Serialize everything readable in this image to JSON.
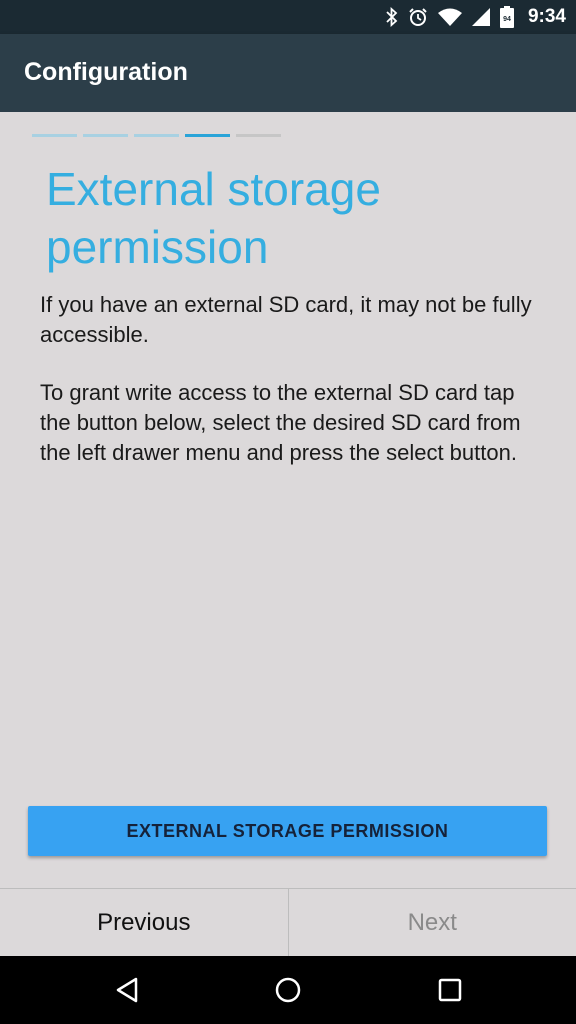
{
  "status_bar": {
    "time": "9:34",
    "battery_level": "94",
    "icons": [
      "bluetooth-icon",
      "alarm-icon",
      "wifi-icon",
      "signal-icon",
      "battery-icon"
    ]
  },
  "app_bar": {
    "title": "Configuration"
  },
  "wizard": {
    "steps_total": 5,
    "current_step": 4,
    "heading": "External storage permission",
    "paragraphs": [
      "If you have an external SD card, it may not be fully accessible.",
      "To grant write access to the external SD card tap the button below, select the desired SD card from the left drawer menu and press the select button."
    ],
    "permission_button_label": "EXTERNAL STORAGE PERMISSION"
  },
  "footer": {
    "previous_label": "Previous",
    "next_label": "Next"
  },
  "nav_bar": {
    "icons": [
      "back-icon",
      "home-icon",
      "recents-icon"
    ]
  },
  "colors": {
    "accent": "#35aee0",
    "button": "#37a2f2",
    "app_bar": "#2c3e49",
    "status_bar": "#1b2a33"
  }
}
